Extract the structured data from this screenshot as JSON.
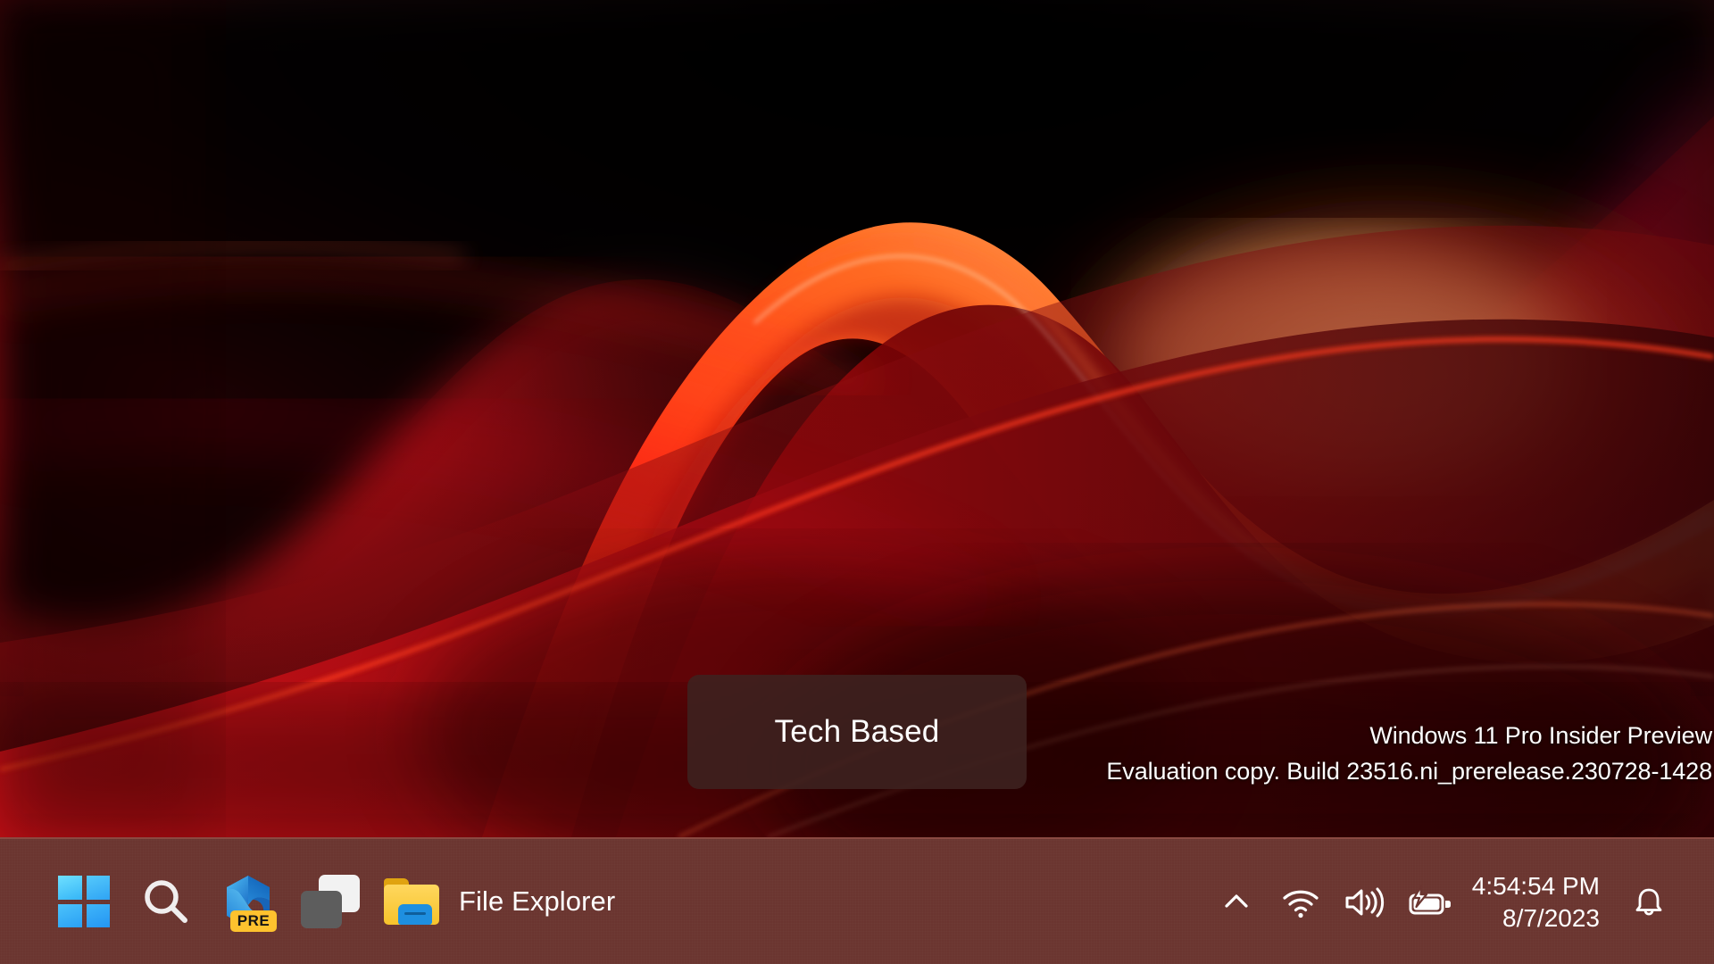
{
  "desktop": {
    "wallpaper_name": "windows-11-bloom-red-abstract",
    "colors": {
      "accent_red": "#e01020",
      "bright_red": "#ff2a12",
      "orange_glow": "#ff9a4a",
      "deep_black": "#050101",
      "dark_maroon": "#3d0709",
      "taskbar_bg": "#6b3530",
      "taskbar_border": "#8a4a42"
    }
  },
  "watermark": {
    "line1": "Windows 11 Pro Insider Preview",
    "line2": "Evaluation copy. Build 23516.ni_prerelease.230728-1428"
  },
  "tech_card": {
    "label": "Tech Based"
  },
  "taskbar": {
    "items": [
      {
        "name": "start",
        "label": "Start",
        "icon": "windows-logo-icon"
      },
      {
        "name": "search",
        "label": "Search",
        "icon": "search-icon"
      },
      {
        "name": "edge",
        "label": "Microsoft Edge",
        "icon": "edge-icon",
        "badge": "PRE"
      },
      {
        "name": "task-view",
        "label": "Task View",
        "icon": "task-view-icon"
      },
      {
        "name": "file-explorer",
        "label": "File Explorer",
        "icon": "folder-icon"
      }
    ],
    "tray": {
      "show_hidden_icons": {
        "label": "Show hidden icons",
        "icon": "chevron-up-icon"
      },
      "network": {
        "label": "Network",
        "icon": "wifi-icon"
      },
      "volume": {
        "label": "Volume",
        "icon": "speaker-icon"
      },
      "battery": {
        "label": "Battery charging",
        "icon": "battery-charging-icon"
      },
      "clock": {
        "time": "4:54:54 PM",
        "date": "8/7/2023"
      },
      "notifications": {
        "label": "Notifications",
        "icon": "bell-icon"
      }
    }
  }
}
